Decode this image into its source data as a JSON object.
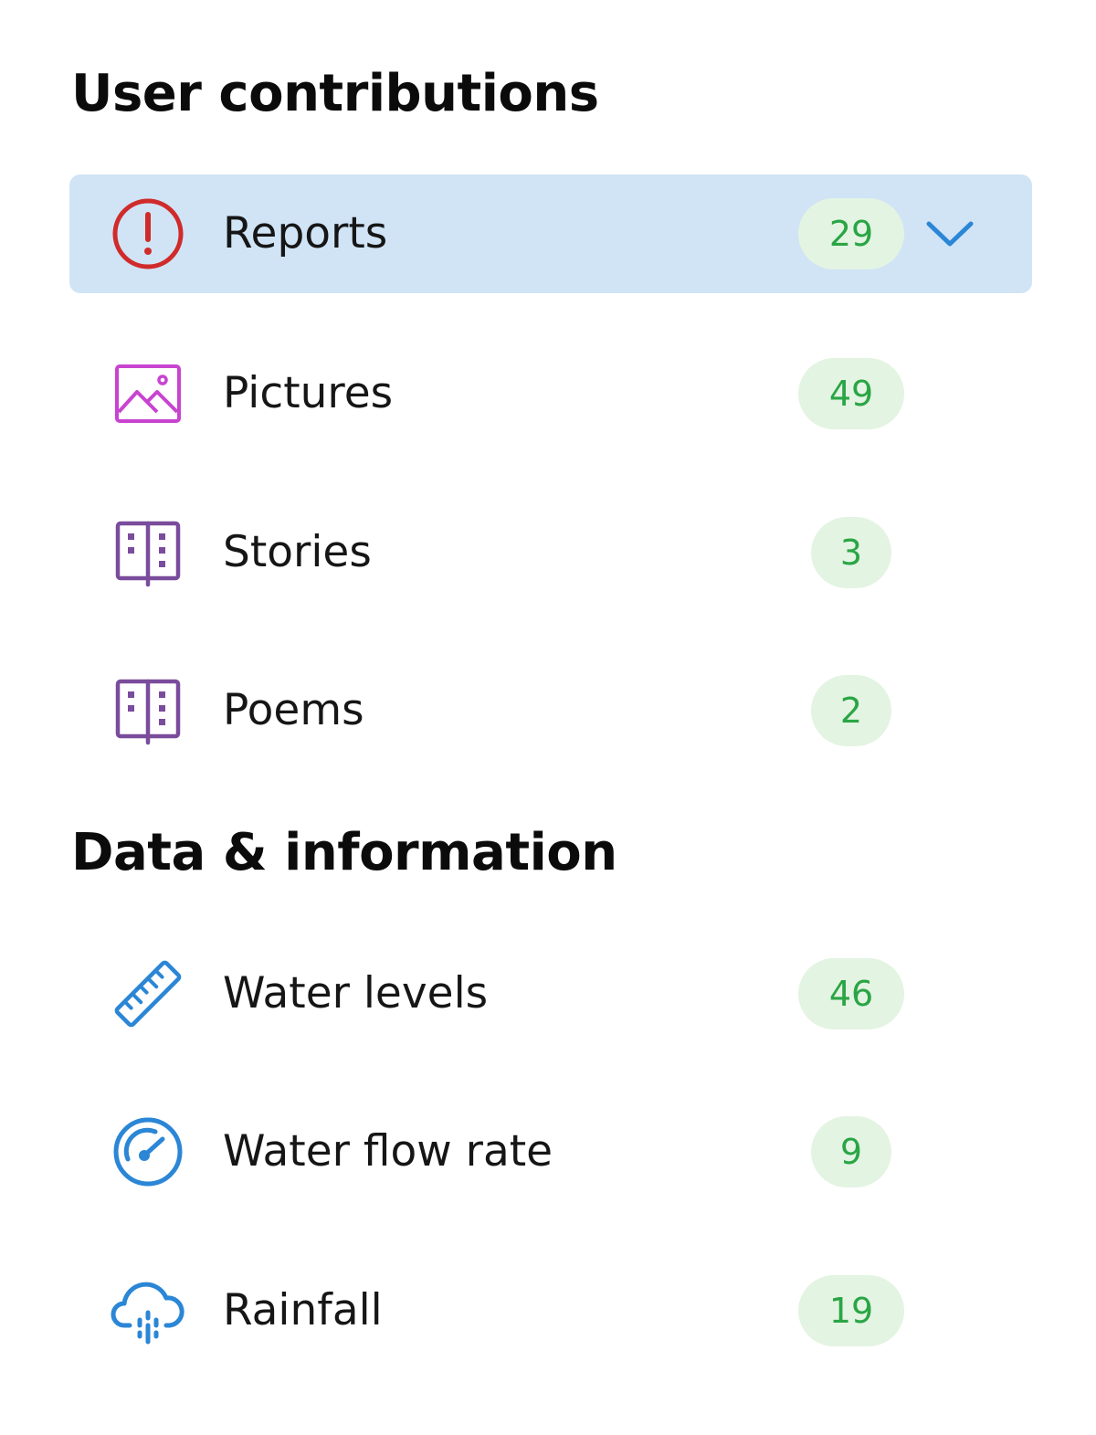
{
  "sections": [
    {
      "title": "User contributions",
      "items": [
        {
          "label": "Reports",
          "count": "29",
          "icon": "alert-circle-icon",
          "color": "#d02b2b",
          "selected": true
        },
        {
          "label": "Pictures",
          "count": "49",
          "icon": "image-icon",
          "color": "#c844d0",
          "selected": false
        },
        {
          "label": "Stories",
          "count": "3",
          "icon": "book-open-icon",
          "color": "#7a4c9c",
          "selected": false
        },
        {
          "label": "Poems",
          "count": "2",
          "icon": "book-open-icon",
          "color": "#7a4c9c",
          "selected": false
        }
      ]
    },
    {
      "title": "Data & information",
      "items": [
        {
          "label": "Water levels",
          "count": "46",
          "icon": "ruler-icon",
          "color": "#2b86d6",
          "selected": false
        },
        {
          "label": "Water flow rate",
          "count": "9",
          "icon": "gauge-icon",
          "color": "#2b86d6",
          "selected": false
        },
        {
          "label": "Rainfall",
          "count": "19",
          "icon": "rain-cloud-icon",
          "color": "#2b86d6",
          "selected": false
        }
      ]
    }
  ],
  "colors": {
    "selected_background": "#d0e4f6",
    "badge_background": "#e3f4e2",
    "badge_text": "#2aa545",
    "chevron": "#2b86d6"
  }
}
